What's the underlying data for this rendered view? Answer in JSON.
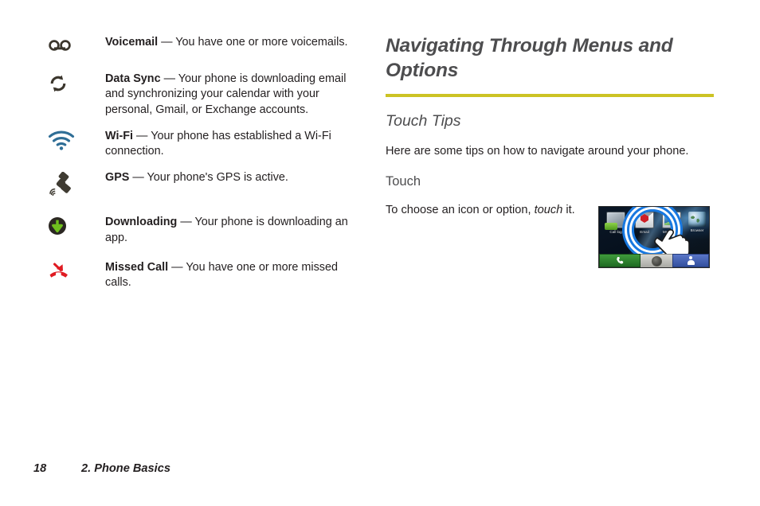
{
  "document": {
    "page_number": "18",
    "footer_section": "2. Phone Basics"
  },
  "status_icons": {
    "items": [
      {
        "icon": "voicemail-icon",
        "term": "Voicemail",
        "separator": " — ",
        "description": "You have one or more voicemails."
      },
      {
        "icon": "data-sync-icon",
        "term": "Data Sync",
        "separator": " — ",
        "description": "Your phone is downloading email and synchronizing your calendar with your personal, Gmail, or Exchange accounts."
      },
      {
        "icon": "wifi-icon",
        "term": "Wi-Fi",
        "separator": " — ",
        "description": "Your phone has established a Wi-Fi connection."
      },
      {
        "icon": "gps-satellite-icon",
        "term": "GPS",
        "separator": " — ",
        "description": "Your phone's GPS is active."
      },
      {
        "icon": "downloading-icon",
        "term": "Downloading",
        "separator": " — ",
        "description": "Your phone is downloading an app."
      },
      {
        "icon": "missed-call-icon",
        "term": "Missed Call",
        "separator": " — ",
        "description": "You have one or more missed calls."
      }
    ]
  },
  "section": {
    "heading": "Navigating Through Menus and Options",
    "rule_color": "#ccc324",
    "subheading": "Touch Tips",
    "intro": "Here are some tips on how to navigate around your phone.",
    "touch_heading": "Touch",
    "touch_body_before": "To choose an icon or option, ",
    "touch_body_emphasis": "touch",
    "touch_body_after": " it."
  },
  "phone_screenshot": {
    "name": "home-screen-touch-illustration",
    "apps": [
      {
        "label": "Call log",
        "icon": "call-log-icon"
      },
      {
        "label": "Email",
        "icon": "email-icon"
      },
      {
        "label": "Messaging",
        "icon": "messaging-icon"
      },
      {
        "label": "Browser",
        "icon": "browser-globe-icon"
      }
    ],
    "ripple": "touch-ripple-indicator",
    "hand": "hand-pointer-icon",
    "dock": [
      {
        "name": "phone-dock-button",
        "icon": "handset-icon"
      },
      {
        "name": "launcher-dock-button",
        "icon": "app-drawer-icon"
      },
      {
        "name": "contacts-dock-button",
        "icon": "contact-person-icon"
      }
    ]
  },
  "colors": {
    "wifi_blue": "#2f6e96",
    "download_green": "#6fbf1e",
    "missed_call_red": "#e01b22",
    "heading_gray": "#4d4d4f",
    "body_black": "#231f20"
  }
}
